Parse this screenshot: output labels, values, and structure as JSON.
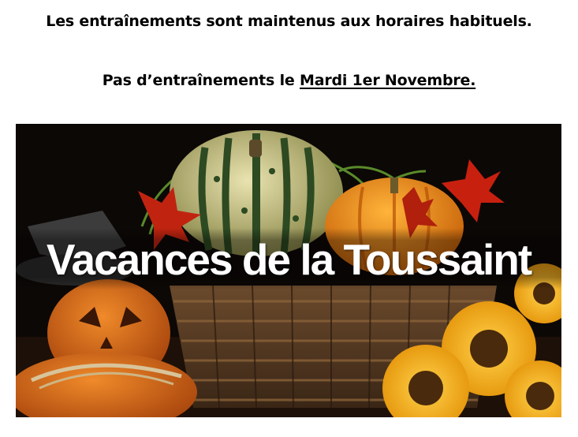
{
  "notice": {
    "line1": "Les entraînements sont maintenus aux horaires habituels.",
    "line2_prefix": "Pas d’entraînements le ",
    "line2_date": "Mardi 1er Novembre."
  },
  "banner": {
    "title": "Vacances de la Toussaint"
  }
}
